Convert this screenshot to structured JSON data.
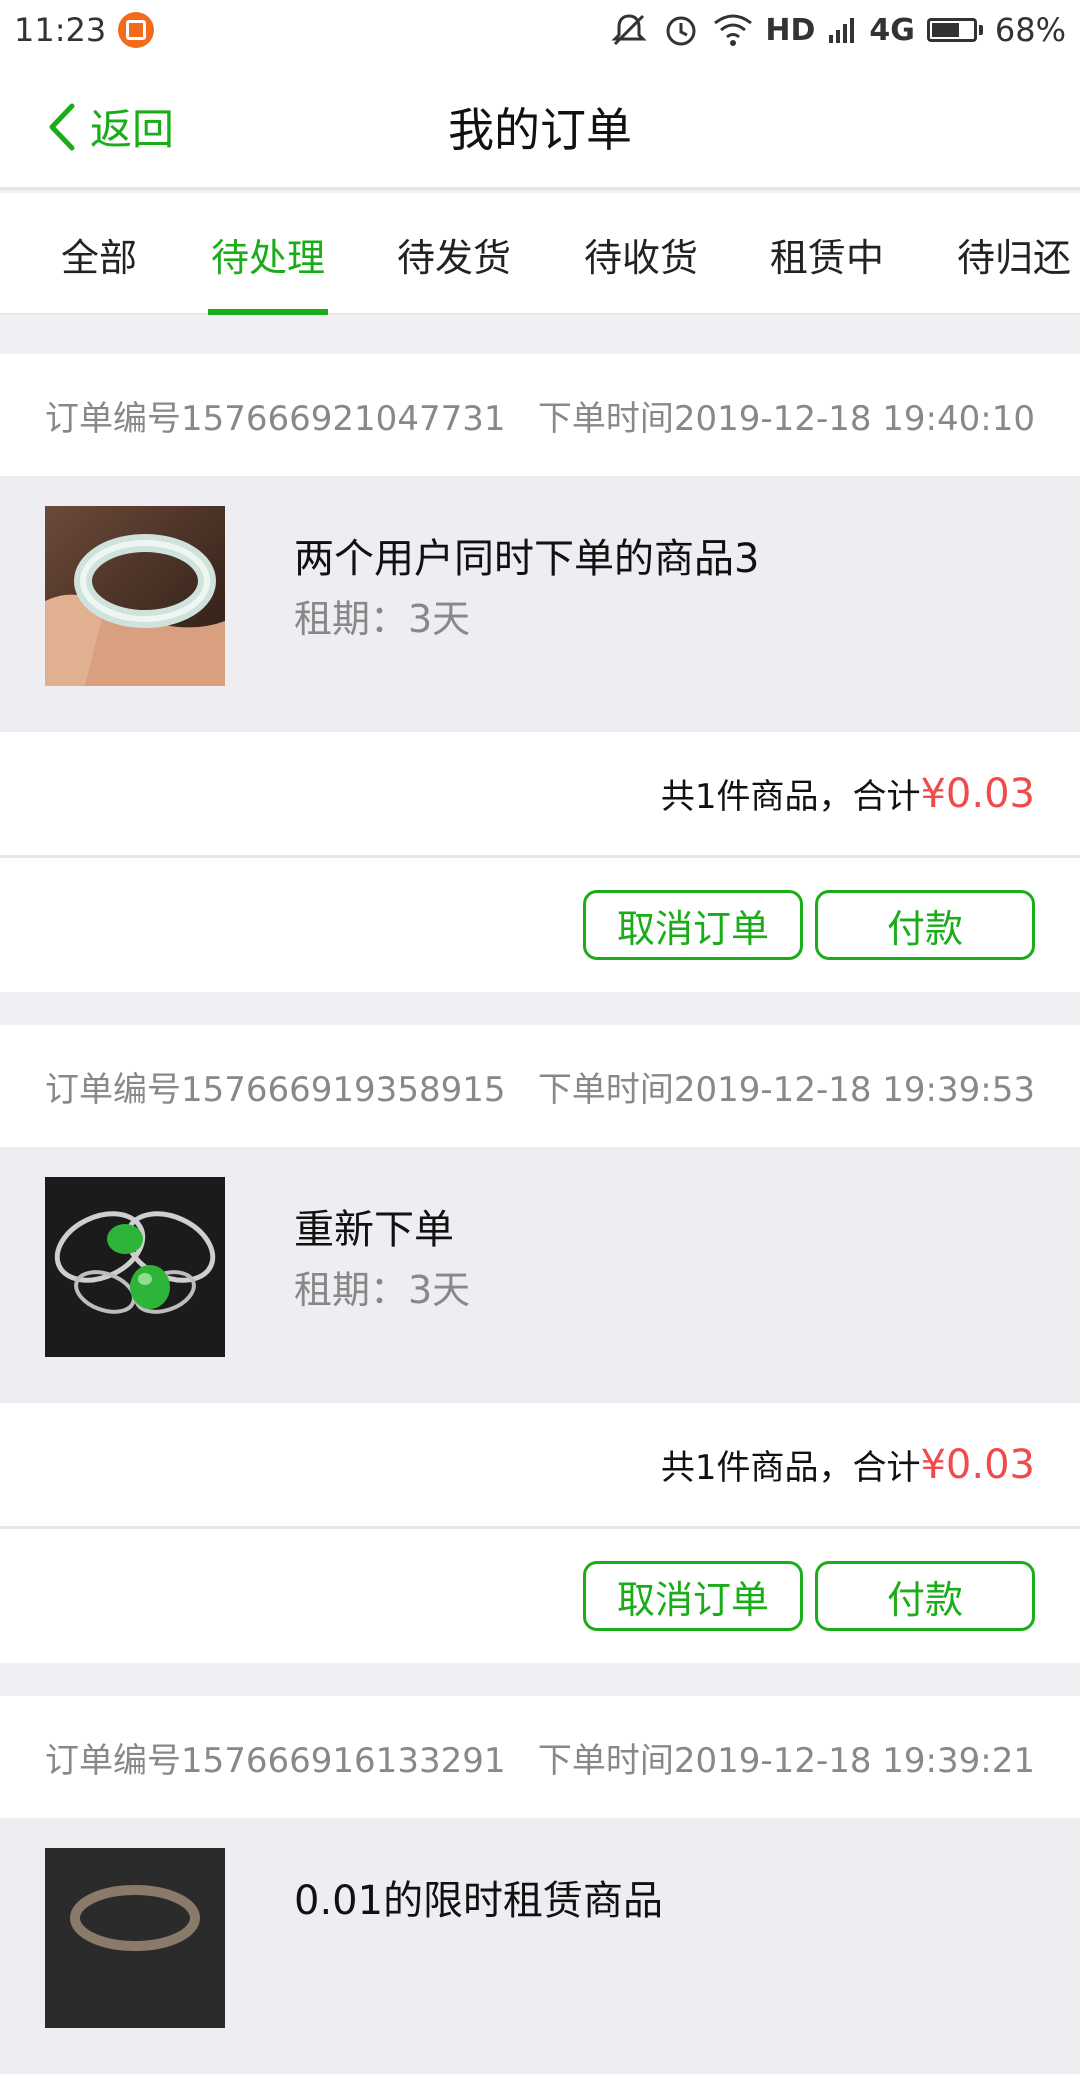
{
  "status_bar": {
    "time": "11:23",
    "network": "HD",
    "signal_type": "4G",
    "battery": "68%",
    "battery_level": 0.68
  },
  "nav": {
    "back_label": "返回",
    "title": "我的订单"
  },
  "tabs": [
    {
      "label": "全部"
    },
    {
      "label": "待处理"
    },
    {
      "label": "待发货"
    },
    {
      "label": "待收货"
    },
    {
      "label": "租赁中"
    },
    {
      "label": "待归还"
    }
  ],
  "active_tab": "待处理",
  "orders": [
    {
      "number": "订单编号157666921047731",
      "time": "下单时间2019-12-18 19:40:10",
      "item_name": "两个用户同时下单的商品3",
      "period": "租期：3天",
      "total_prefix": "共1件商品，合计",
      "total_price": "¥0.03",
      "cancel_label": "取消订单",
      "pay_label": "付款"
    },
    {
      "number": "订单编号157666919358915",
      "time": "下单时间2019-12-18 19:39:53",
      "item_name": "重新下单",
      "period": "租期：3天",
      "total_prefix": "共1件商品，合计",
      "total_price": "¥0.03",
      "cancel_label": "取消订单",
      "pay_label": "付款"
    },
    {
      "number": "订单编号157666916133291",
      "time": "下单时间2019-12-18 19:39:21",
      "item_name": "0.01的限时租赁商品"
    }
  ],
  "colors": {
    "accent": "#1aad19",
    "price": "#f04a4a",
    "muted": "#888888",
    "bg": "#efeff4"
  }
}
